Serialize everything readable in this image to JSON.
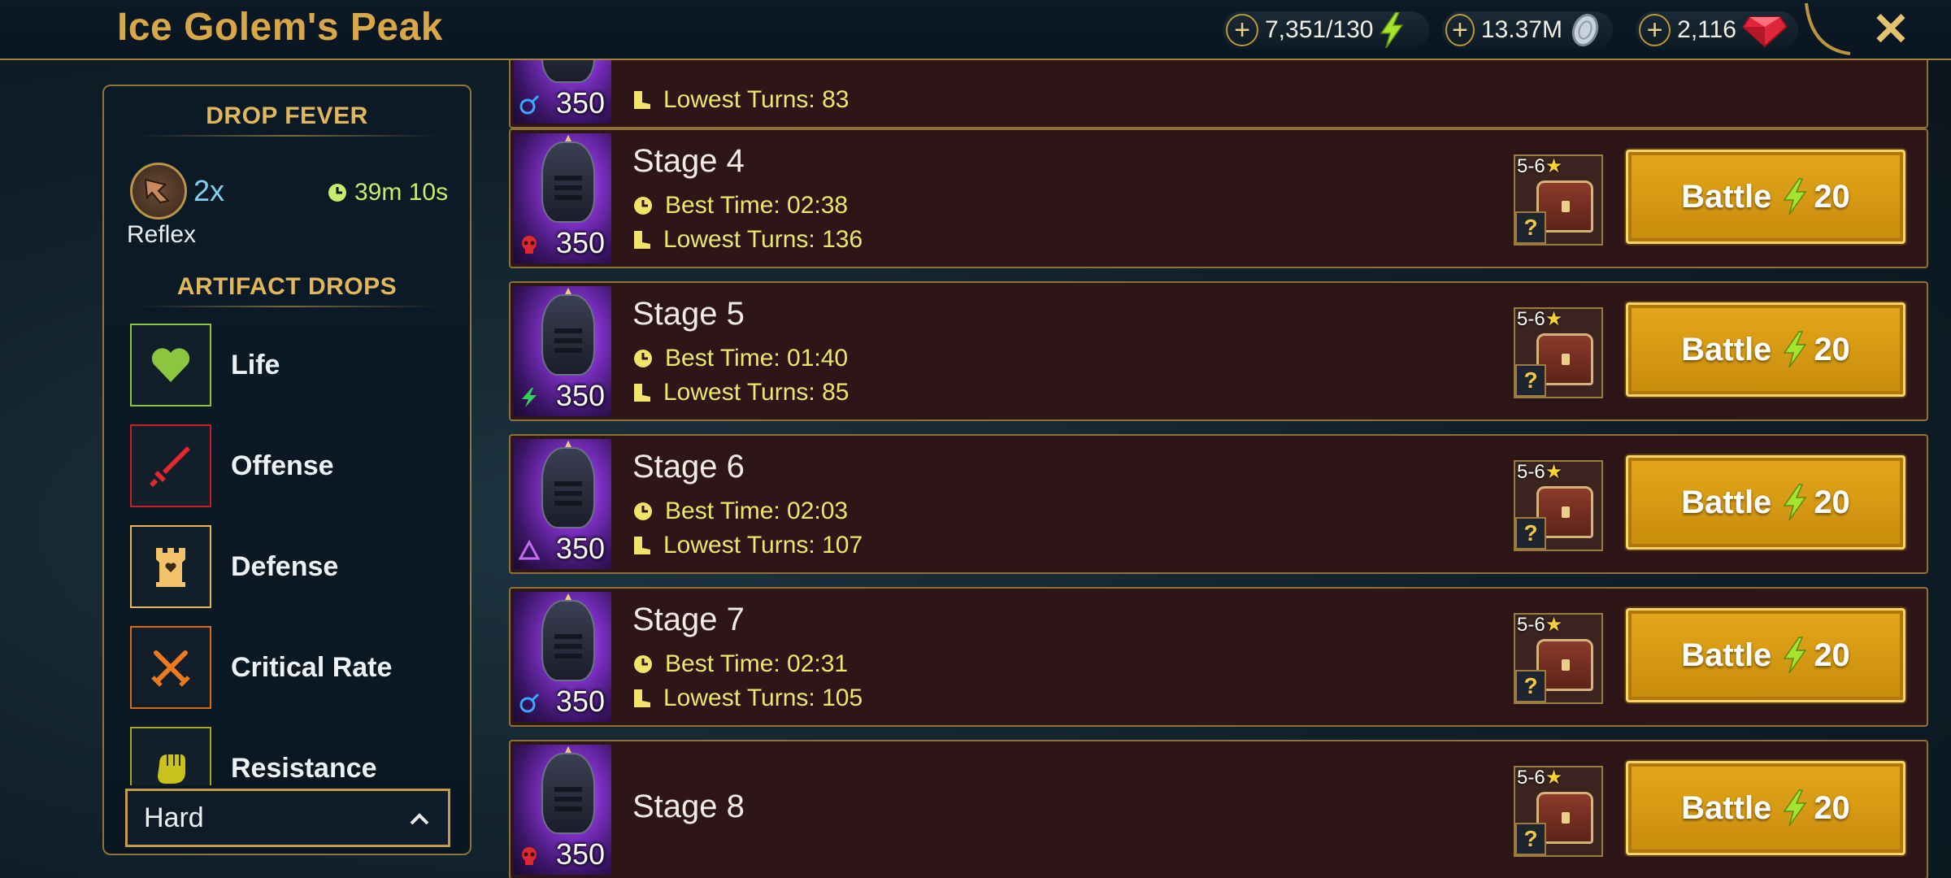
{
  "header": {
    "title": "Ice Golem's Peak",
    "resources": [
      {
        "value": "7,351/130",
        "icon": "energy-bolt-icon"
      },
      {
        "value": "13.37M",
        "icon": "silver-coin-icon"
      },
      {
        "value": "2,116",
        "icon": "gem-icon"
      }
    ],
    "close_icon": "close-icon"
  },
  "panel": {
    "drop_fever_title": "DROP FEVER",
    "fever_multiplier": "2x",
    "fever_timer": "39m 10s",
    "fever_set": "Reflex",
    "artifact_drops_title": "ARTIFACT DROPS",
    "drops": [
      {
        "label": "Life",
        "color": "#8cc63f"
      },
      {
        "label": "Offense",
        "color": "#d8262a"
      },
      {
        "label": "Defense",
        "color": "#f2c26b"
      },
      {
        "label": "Critical Rate",
        "color": "#ee7a1f"
      },
      {
        "label": "Resistance",
        "color": "#c9c21c"
      }
    ],
    "difficulty": "Hard"
  },
  "stages": [
    {
      "name": "",
      "power": "350",
      "affinity": "magic",
      "best_time": "",
      "lowest_turns": "Lowest Turns: 83",
      "reward_rank": "",
      "battle_label": "",
      "energy_cost": ""
    },
    {
      "name": "Stage 4",
      "power": "350",
      "affinity": "force",
      "best_time": "Best Time: 02:38",
      "lowest_turns": "Lowest Turns: 136",
      "reward_rank": "5-6",
      "battle_label": "Battle",
      "energy_cost": "20"
    },
    {
      "name": "Stage 5",
      "power": "350",
      "affinity": "spirit",
      "best_time": "Best Time: 01:40",
      "lowest_turns": "Lowest Turns: 85",
      "reward_rank": "5-6",
      "battle_label": "Battle",
      "energy_cost": "20"
    },
    {
      "name": "Stage 6",
      "power": "350",
      "affinity": "void",
      "best_time": "Best Time: 02:03",
      "lowest_turns": "Lowest Turns: 107",
      "reward_rank": "5-6",
      "battle_label": "Battle",
      "energy_cost": "20"
    },
    {
      "name": "Stage 7",
      "power": "350",
      "affinity": "magic",
      "best_time": "Best Time: 02:31",
      "lowest_turns": "Lowest Turns: 105",
      "reward_rank": "5-6",
      "battle_label": "Battle",
      "energy_cost": "20"
    },
    {
      "name": "Stage 8",
      "power": "350",
      "affinity": "force",
      "best_time": "",
      "lowest_turns": "",
      "reward_rank": "5-6",
      "battle_label": "Battle",
      "energy_cost": "20"
    }
  ]
}
